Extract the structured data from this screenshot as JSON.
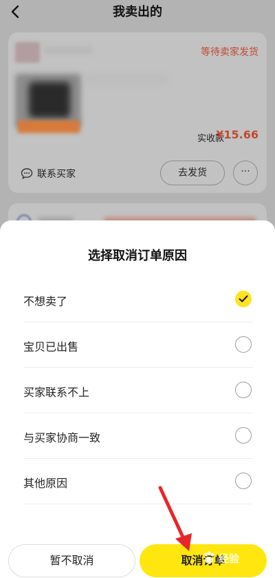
{
  "header": {
    "title": "我卖出的"
  },
  "order": {
    "status": "等待卖家发货",
    "amount_label": "实收款",
    "amount_value": "¥15.66",
    "contact_label": "联系买家",
    "ship_label": "去发货",
    "more_label": "···"
  },
  "sheet": {
    "title": "选择取消订单原因",
    "reasons": [
      {
        "label": "不想卖了",
        "selected": true
      },
      {
        "label": "宝贝已出售",
        "selected": false
      },
      {
        "label": "买家联系不上",
        "selected": false
      },
      {
        "label": "与买家协商一致",
        "selected": false
      },
      {
        "label": "其他原因",
        "selected": false
      }
    ],
    "keep_label": "暂不取消",
    "confirm_label": "取消订单"
  },
  "colors": {
    "accent": "#ffe60f",
    "status_red": "#c04a33",
    "annotation_arrow": "#e8262a"
  },
  "watermark": {
    "text": "经验"
  }
}
